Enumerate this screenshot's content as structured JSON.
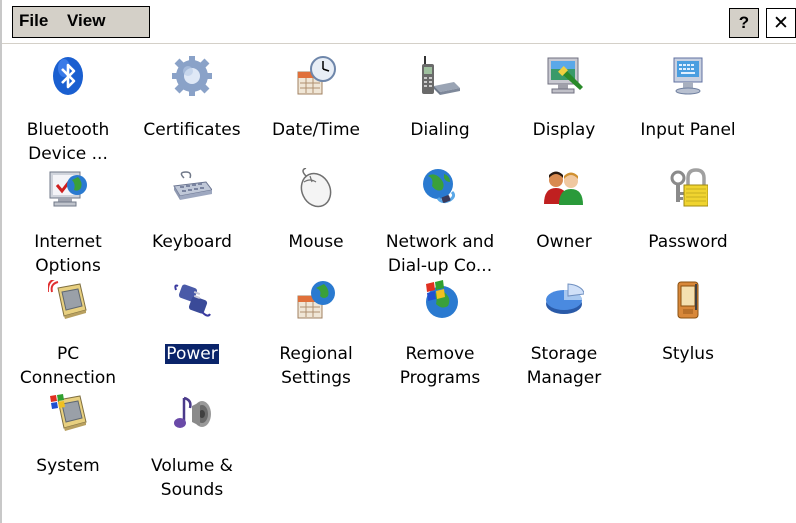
{
  "menubar": {
    "file": "File",
    "view": "View",
    "help": "?",
    "close": "✕"
  },
  "items": [
    {
      "label": "Bluetooth\nDevice ...",
      "icon": "bluetooth-icon"
    },
    {
      "label": "Certificates",
      "icon": "certificates-icon"
    },
    {
      "label": "Date/Time",
      "icon": "calendar-clock-icon"
    },
    {
      "label": "Dialing",
      "icon": "phone-icon"
    },
    {
      "label": "Display",
      "icon": "display-icon"
    },
    {
      "label": "Input Panel",
      "icon": "input-panel-icon"
    },
    {
      "label": "Internet\nOptions",
      "icon": "internet-globe-icon"
    },
    {
      "label": "Keyboard",
      "icon": "keyboard-icon"
    },
    {
      "label": "Mouse",
      "icon": "mouse-icon"
    },
    {
      "label": "Network and\nDial-up Co...",
      "icon": "network-globe-icon"
    },
    {
      "label": "Owner",
      "icon": "owner-people-icon"
    },
    {
      "label": "Password",
      "icon": "password-lock-icon"
    },
    {
      "label": "PC\nConnection",
      "icon": "pc-connection-icon"
    },
    {
      "label": "Power",
      "icon": "power-plug-icon",
      "selected": true
    },
    {
      "label": "Regional\nSettings",
      "icon": "regional-globe-calendar-icon"
    },
    {
      "label": "Remove\nPrograms",
      "icon": "remove-programs-icon"
    },
    {
      "label": "Storage\nManager",
      "icon": "storage-pie-icon"
    },
    {
      "label": "Stylus",
      "icon": "stylus-pda-icon"
    },
    {
      "label": "System",
      "icon": "system-pda-icon"
    },
    {
      "label": "Volume &\nSounds",
      "icon": "volume-speaker-icon"
    }
  ]
}
